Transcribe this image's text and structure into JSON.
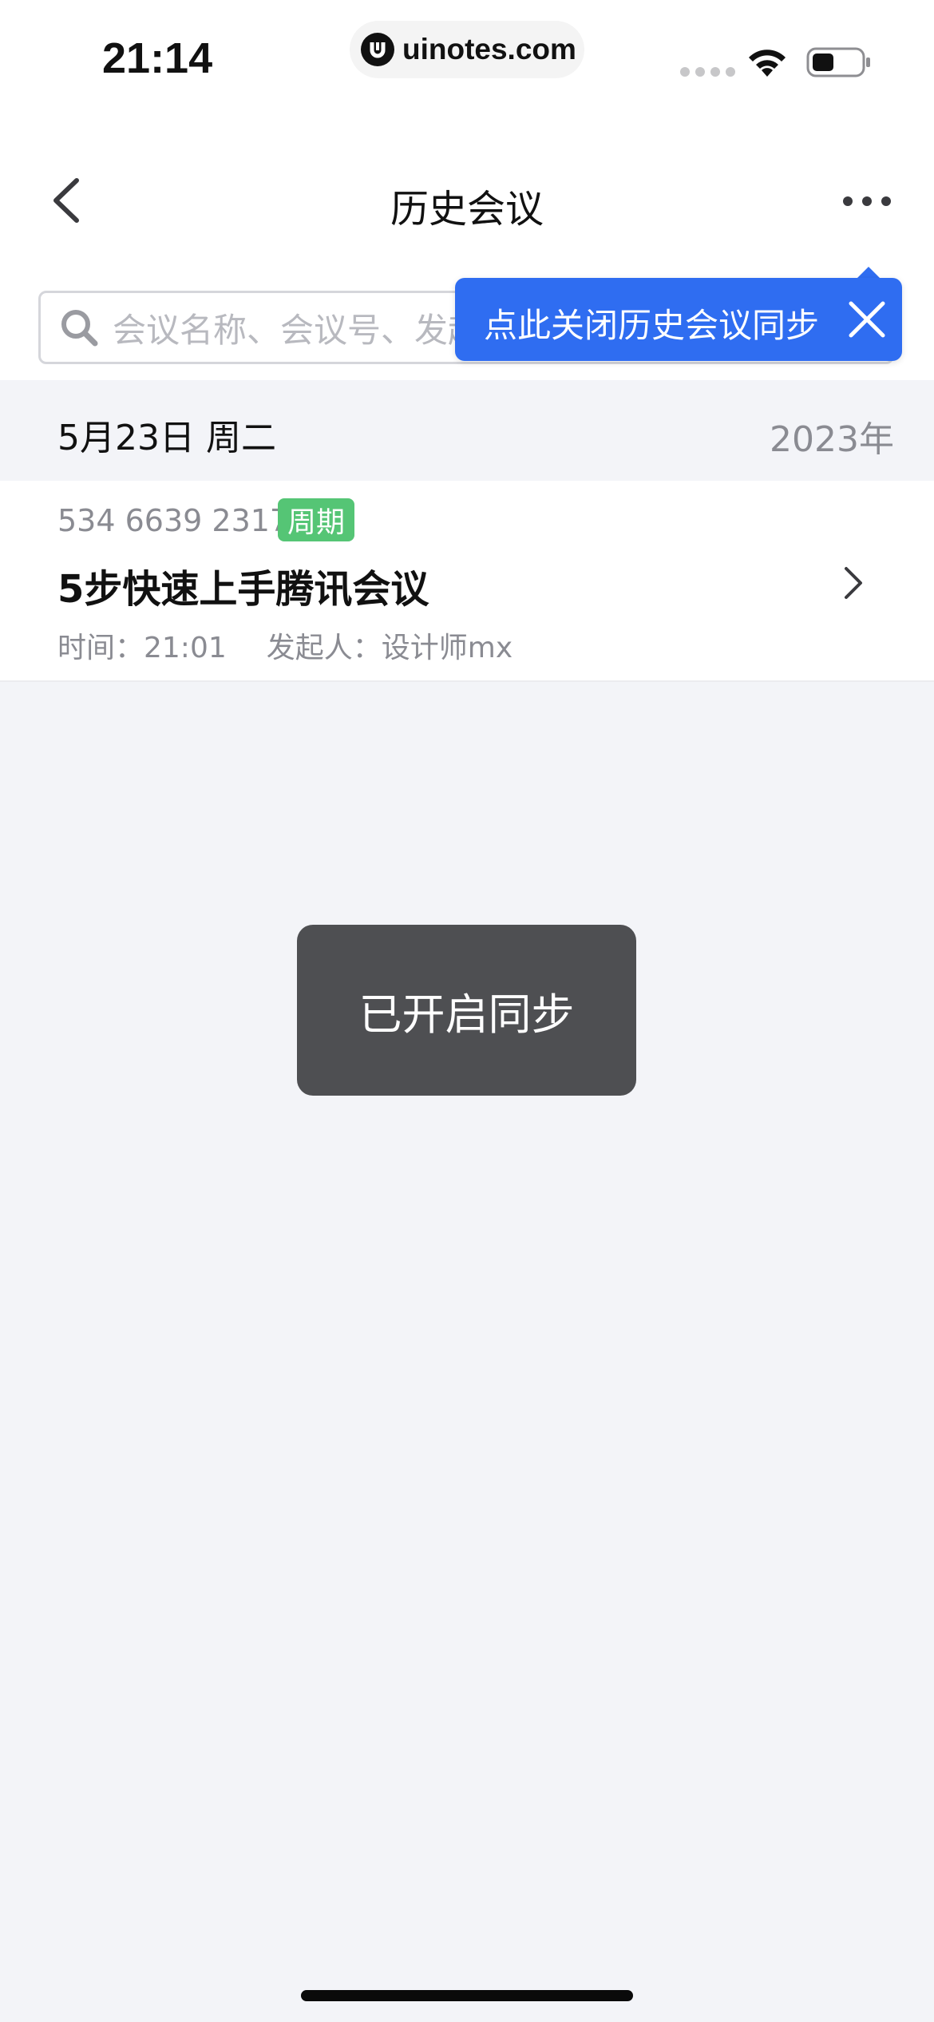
{
  "status_bar": {
    "time": "21:14",
    "site": "uinotes.com"
  },
  "nav": {
    "title": "历史会议"
  },
  "search": {
    "placeholder": "会议名称、会议号、发起"
  },
  "tooltip": {
    "text": "点此关闭历史会议同步"
  },
  "date_section": {
    "date": "5月23日 周二",
    "year": "2023年"
  },
  "meeting": {
    "id": "534 6639 2317",
    "badge": "周期",
    "title": "5步快速上手腾讯会议",
    "time": "时间：21:01",
    "organizer": "发起人：设计师mx"
  },
  "toast": {
    "text": "已开启同步"
  },
  "colors": {
    "accent_blue": "#2f6df1",
    "badge_green": "#55c575",
    "toast_bg": "#4e4f52",
    "page_bg": "#f3f4f8"
  }
}
